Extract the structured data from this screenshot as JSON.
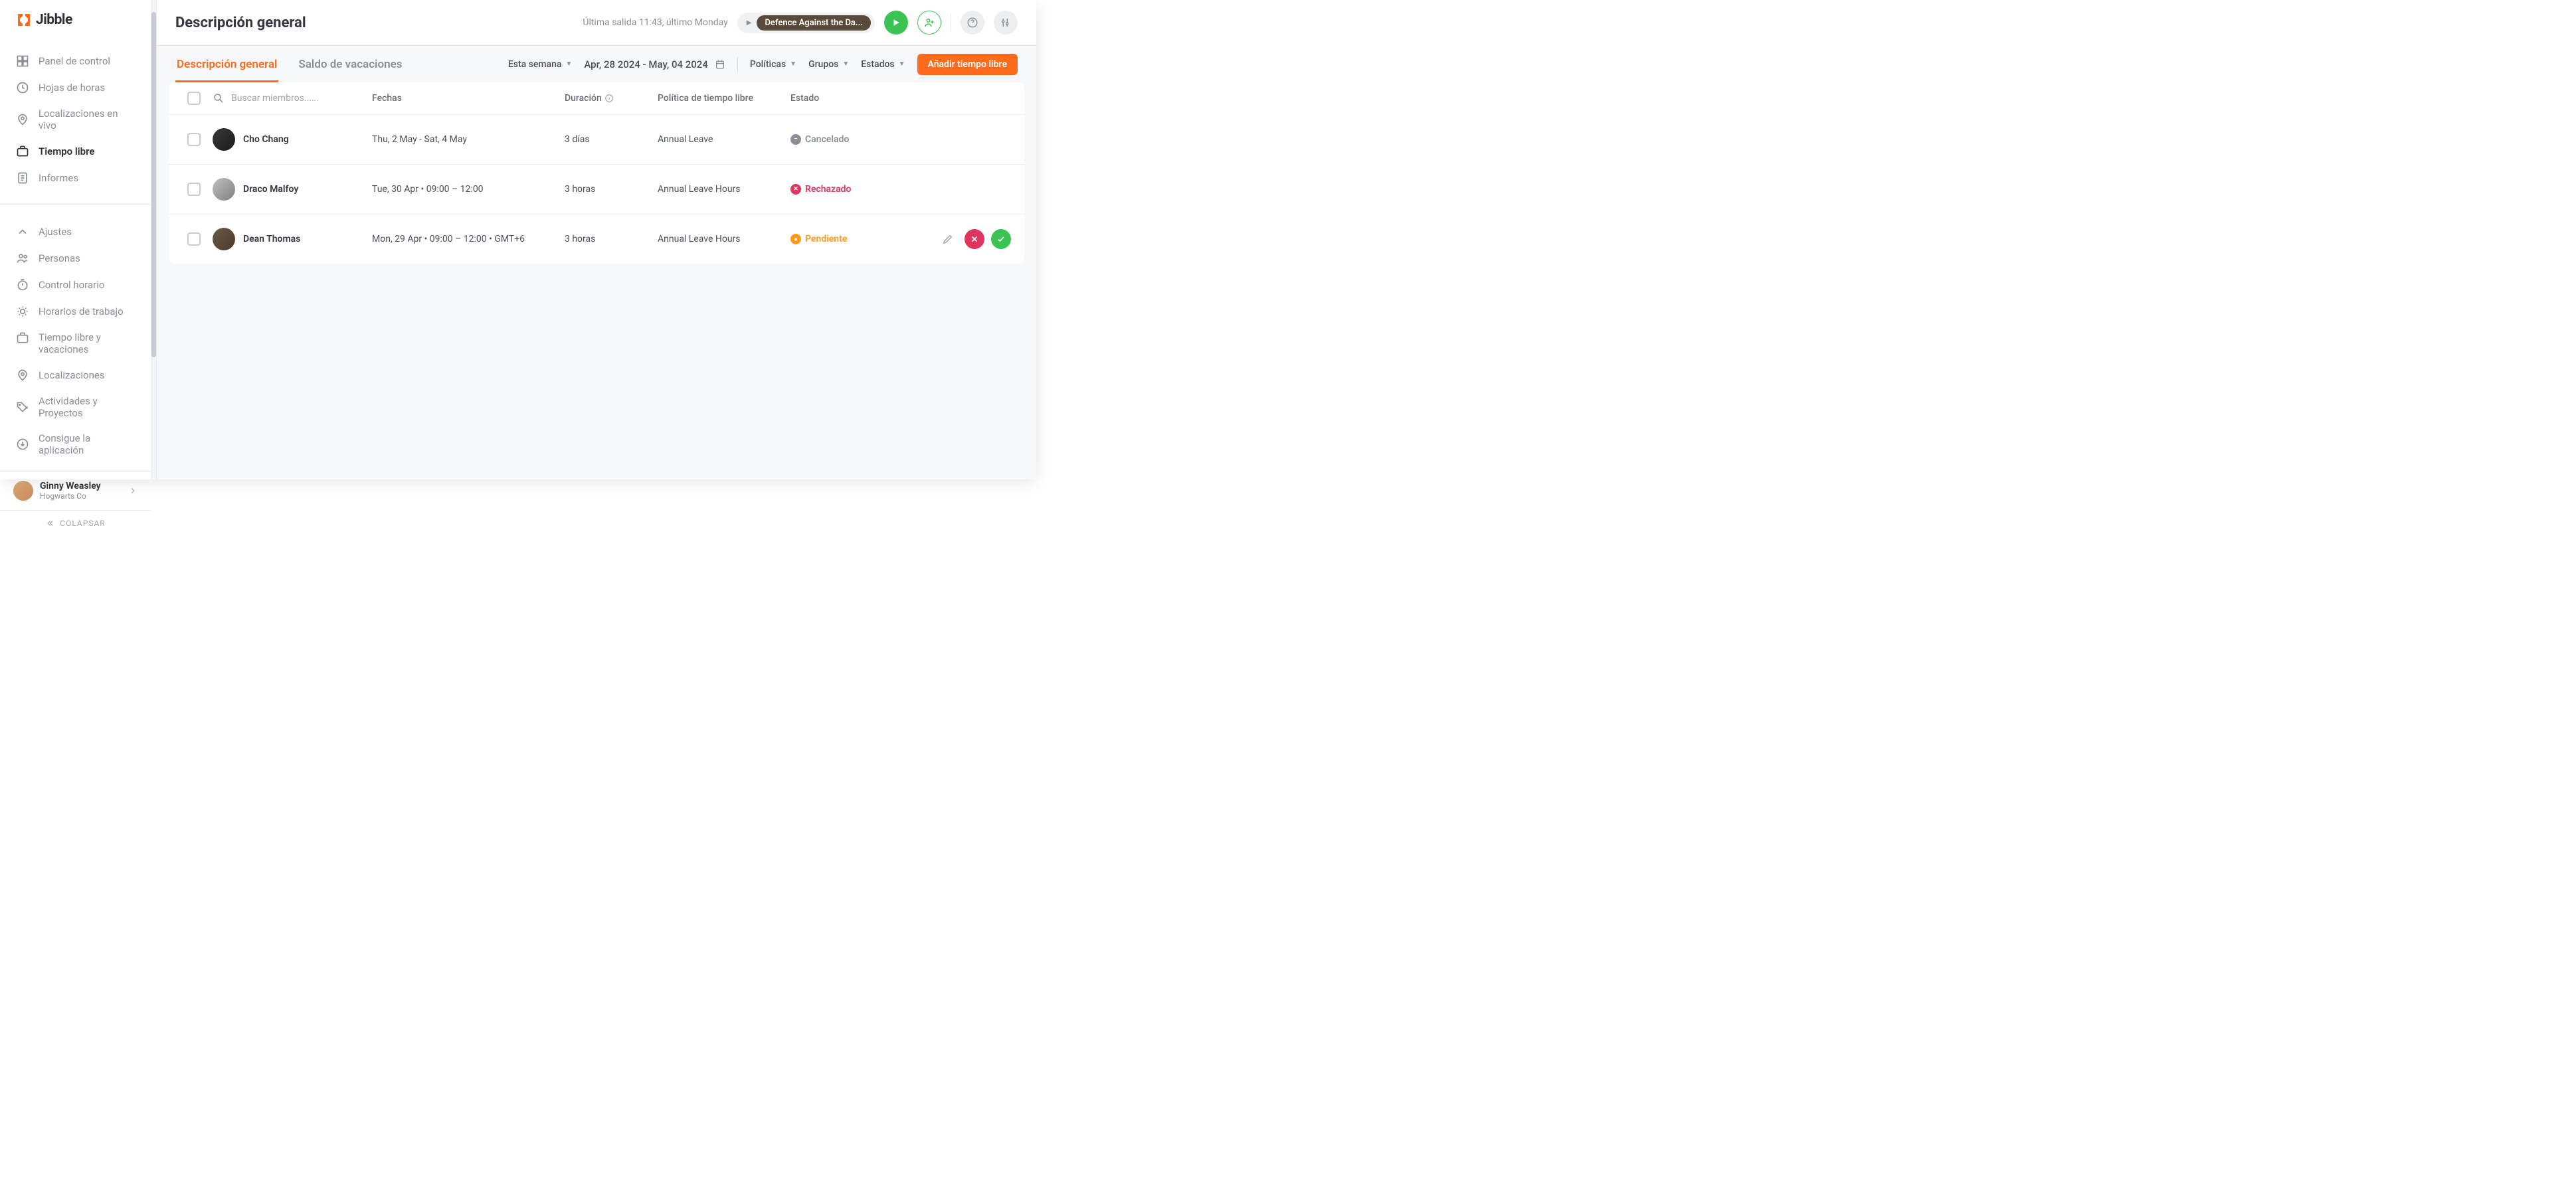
{
  "brand": "Jibble",
  "sidebar": {
    "nav_main": [
      {
        "label": "Panel de control",
        "active": false
      },
      {
        "label": "Hojas de horas",
        "active": false
      },
      {
        "label": "Localizaciones en vivo",
        "active": false
      },
      {
        "label": "Tiempo libre",
        "active": true
      },
      {
        "label": "Informes",
        "active": false
      }
    ],
    "nav_settings": [
      {
        "label": "Ajustes"
      },
      {
        "label": "Personas"
      },
      {
        "label": "Control horario"
      },
      {
        "label": "Horarios de trabajo"
      },
      {
        "label": "Tiempo libre y vacaciones"
      },
      {
        "label": "Localizaciones"
      },
      {
        "label": "Actividades y Proyectos"
      },
      {
        "label": "Consigue la aplicación"
      }
    ],
    "user": {
      "name": "Ginny Weasley",
      "org": "Hogwarts Co"
    },
    "collapse_label": "COLAPSAR"
  },
  "header": {
    "title": "Descripción general",
    "last_exit": "Última salida 11:43, último Monday",
    "badge": "Defence Against the Da..."
  },
  "tabs": {
    "overview": "Descripción general",
    "balance": "Saldo de vacaciones"
  },
  "filters": {
    "week": "Esta semana",
    "date_range": "Apr, 28 2024 - May, 04 2024",
    "policies": "Políticas",
    "groups": "Grupos",
    "statuses": "Estados",
    "add_button": "Añadir tiempo libre"
  },
  "columns": {
    "search_placeholder": "Buscar miembros......",
    "dates": "Fechas",
    "duration": "Duración",
    "policy": "Política de tiempo libre",
    "status": "Estado"
  },
  "rows": [
    {
      "name": "Cho Chang",
      "dates": "Thu, 2 May - Sat, 4 May",
      "duration": "3 días",
      "policy": "Annual Leave",
      "status_label": "Cancelado",
      "status_type": "cancelled",
      "show_actions": false
    },
    {
      "name": "Draco Malfoy",
      "dates": "Tue, 30 Apr • 09:00 – 12:00",
      "duration": "3 horas",
      "policy": "Annual Leave Hours",
      "status_label": "Rechazado",
      "status_type": "rejected",
      "show_actions": false
    },
    {
      "name": "Dean Thomas",
      "dates": "Mon, 29 Apr • 09:00 – 12:00 • GMT+6",
      "duration": "3 horas",
      "policy": "Annual Leave Hours",
      "status_label": "Pendiente",
      "status_type": "pending",
      "show_actions": true
    }
  ]
}
